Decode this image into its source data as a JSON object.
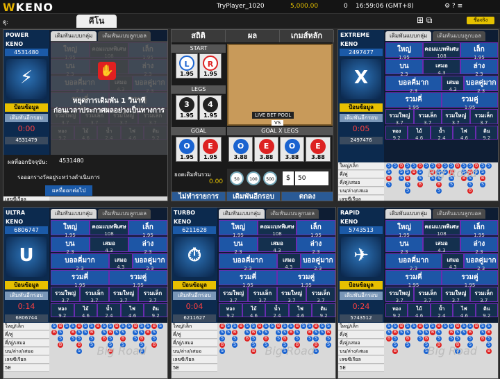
{
  "app": {
    "logo_w": "W",
    "logo_text": "KENO",
    "player": "TryPlayer_1020",
    "balance": "5,000.00",
    "count": "0",
    "time": "16:59:06 (GMT+8)",
    "tab": "คีโน",
    "menu": "ชื่อจริง",
    "colon": "ดู:"
  },
  "tabs": {
    "group": "เดิมพันแบบกลุ่ม",
    "ball": "เดิมพันแบบลูกบอล"
  },
  "labels": {
    "big": "ใหญ่",
    "small": "เล็ก",
    "mid": "คอมแบทพิเศษ",
    "up": "บน",
    "tie": "เสมอ",
    "down": "ล่าง",
    "odd": "บอลคี่มาก",
    "even": "บอลคู่มาก",
    "sumodd": "รวมคี่",
    "sumeven": "รวมคู่",
    "info": "ป้อนข้อมูล",
    "rebet": "เดิมพันอีกรอบ",
    "gold": "ทอง",
    "wood": "ไม้",
    "water": "น้ำ",
    "fire": "ไฟ",
    "earth": "ดิน",
    "bigsmall": "ใหญ่/เล็ก",
    "oddeven": "คี่/คู่",
    "oeex": "คี่/คู่/เสมอ",
    "updown": "บน/ล่าง/เสมอ",
    "serial": "เลขซีเรียล",
    "fiveE": "5E",
    "roadw": "Big Road",
    "sumbig": "รวมใหญ่",
    "sumsmall": "รวมเล็ก"
  },
  "odds": {
    "bigsmall": "1.95",
    "mid": "108",
    "updown": "2.3",
    "tie": "4.3",
    "oddeven": "2.3",
    "sum": "1.95",
    "sub": "3.7",
    "el1": "9.2",
    "el2": "4.6",
    "el3": "2.4",
    "el4": "4.6",
    "el5": "9.2"
  },
  "games": [
    {
      "name": "POWER",
      "sub": "KENO",
      "id": "4531480",
      "icon": "⚡",
      "timer": "0:00",
      "prev": "4531479"
    },
    {
      "name": "EXTREME",
      "sub": "KENO",
      "id": "2497477",
      "icon": "X",
      "timer": "0:05",
      "prev": "2497476"
    },
    {
      "name": "ULTRA",
      "sub": "KENO",
      "id": "6806747",
      "icon": "U",
      "timer": "0:14",
      "prev": "6806744"
    },
    {
      "name": "TURBO",
      "sub": "KENO",
      "id": "6211628",
      "icon": "⏱",
      "timer": "0:04",
      "prev": "6211627"
    },
    {
      "name": "RAPID",
      "sub": "KENO",
      "id": "5743513",
      "icon": "✈",
      "timer": "0:24",
      "prev": "5743512"
    }
  ],
  "power_overlay": {
    "msg1": "หยุดการเดิมพัน 1 วินาที",
    "msg2": "ก่อนเวลาประกาศผลอย่างเป็นทางการ",
    "result_label": "ผลที่ออกปัจจุบัน:",
    "result_id": "4531480",
    "waiting": "รอออกรางวัลอยู่ระหว่างดำเนินการ",
    "next": "ผลที่ออกต่อไป"
  },
  "center": {
    "h1": "สถิติ",
    "h2": "ผล",
    "h3": "เกมส์หลัก",
    "start": "START",
    "legs": "LEGS",
    "goal": "GOAL",
    "goalx": "GOAL X LEGS",
    "odd": "1.95",
    "oddx": "3.88",
    "bet_total": "ยอดเดิมพันรวม",
    "bet_total_val": "0.00",
    "pool": "LIVE BET POOL",
    "vs": "VS",
    "f1": "ไม่ทำรายการ",
    "f2": "เดิมพันอีกรอบ",
    "f3": "ตกลง",
    "chip1": "50",
    "chip2": "100",
    "chip3": "500",
    "amount": "50"
  },
  "colors": {
    "accent": "#e6c200",
    "blue": "#1d56a6",
    "purple": "#6a2bb0",
    "red": "#d22222"
  }
}
